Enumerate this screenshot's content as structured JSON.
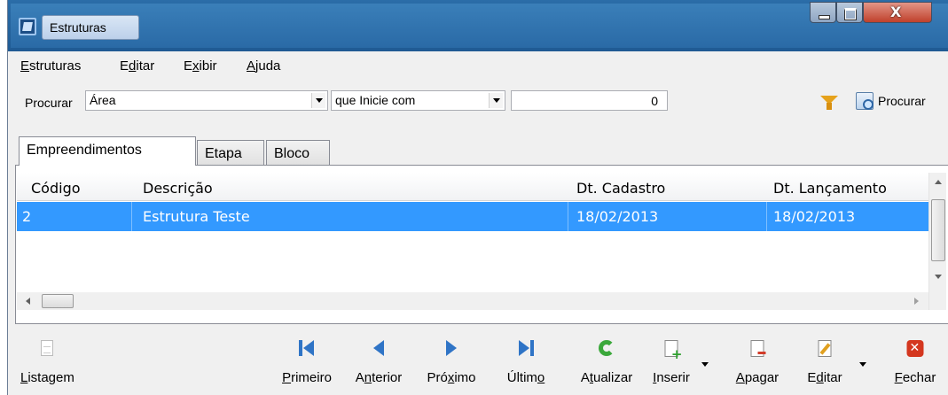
{
  "window": {
    "title": "Estruturas"
  },
  "menu": {
    "estruturas": {
      "pre": "",
      "key": "E",
      "post": "struturas"
    },
    "editar": {
      "pre": "E",
      "key": "d",
      "post": "itar"
    },
    "exibir": {
      "pre": "E",
      "key": "x",
      "post": "ibir"
    },
    "ajuda": {
      "pre": "",
      "key": "A",
      "post": "juda"
    }
  },
  "search": {
    "label": "Procurar",
    "field_value": "Área",
    "condition_value": "que Inicie com",
    "search_value": "0",
    "button_label": "Procurar"
  },
  "tabs": [
    {
      "label": "Empreendimentos"
    },
    {
      "label": "Etapa"
    },
    {
      "label": "Bloco"
    }
  ],
  "grid": {
    "columns": [
      "Código",
      "Descrição",
      "Dt. Cadastro",
      "Dt. Lançamento"
    ],
    "rows": [
      {
        "codigo": "2",
        "descricao": "Estrutura Teste",
        "dt_cadastro": "18/02/2013",
        "dt_lancamento": "18/02/2013"
      }
    ]
  },
  "toolbar": {
    "listagem": {
      "pre": "",
      "key": "L",
      "post": "istagem"
    },
    "primeiro": {
      "pre": "",
      "key": "P",
      "post": "rimeiro"
    },
    "anterior": {
      "pre": "A",
      "key": "n",
      "post": "terior"
    },
    "proximo": {
      "pre": "Pró",
      "key": "x",
      "post": "imo"
    },
    "ultimo": {
      "pre": "Últim",
      "key": "o",
      "post": ""
    },
    "atualizar": {
      "pre": "A",
      "key": "t",
      "post": "ualizar"
    },
    "inserir": {
      "pre": "",
      "key": "I",
      "post": "nserir"
    },
    "apagar": {
      "pre": "",
      "key": "A",
      "post": "pagar"
    },
    "editar": {
      "pre": "E",
      "key": "d",
      "post": "itar"
    },
    "fechar": {
      "pre": "",
      "key": "F",
      "post": "echar"
    }
  },
  "colors": {
    "selection": "#3399ff",
    "nav_blue": "#2f74c6",
    "refresh_green": "#3aa83a",
    "close_red": "#d4371f"
  }
}
